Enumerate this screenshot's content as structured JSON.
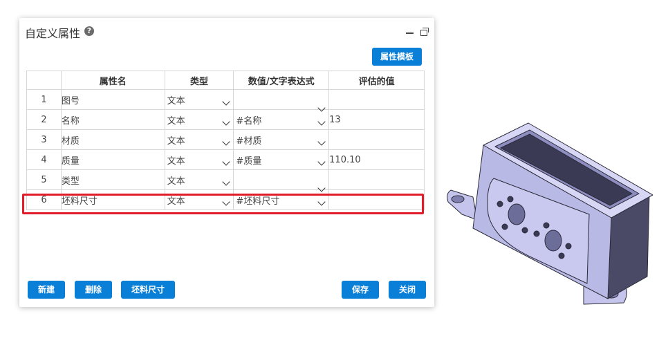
{
  "dialog": {
    "title": "自定义属性",
    "help_icon": "?",
    "template_button": "属性模板"
  },
  "table": {
    "headers": [
      "",
      "属性名",
      "类型",
      "数值/文字表达式",
      "评估的值"
    ],
    "rows": [
      {
        "index": "1",
        "name": "图号",
        "type": "文本",
        "expression": "",
        "value": ""
      },
      {
        "index": "2",
        "name": "名称",
        "type": "文本",
        "expression": "#名称",
        "value": "13"
      },
      {
        "index": "3",
        "name": "材质",
        "type": "文本",
        "expression": "#材质",
        "value": ""
      },
      {
        "index": "4",
        "name": "质量",
        "type": "文本",
        "expression": "#质量",
        "value": "110.10"
      },
      {
        "index": "5",
        "name": "类型",
        "type": "文本",
        "expression": "",
        "value": ""
      },
      {
        "index": "6",
        "name": "坯料尺寸",
        "type": "文本",
        "expression": "#坯料尺寸",
        "value": ""
      }
    ]
  },
  "footer": {
    "new": "新建",
    "delete": "删除",
    "blank_size": "坯料尺寸",
    "save": "保存",
    "close": "关闭"
  },
  "colors": {
    "accent": "#0a7fd8",
    "highlight": "#e21b2a",
    "model": "#b9b9e6"
  },
  "icons": [
    "help-icon",
    "minimize-icon",
    "restore-icon",
    "chevron-down-icon"
  ]
}
